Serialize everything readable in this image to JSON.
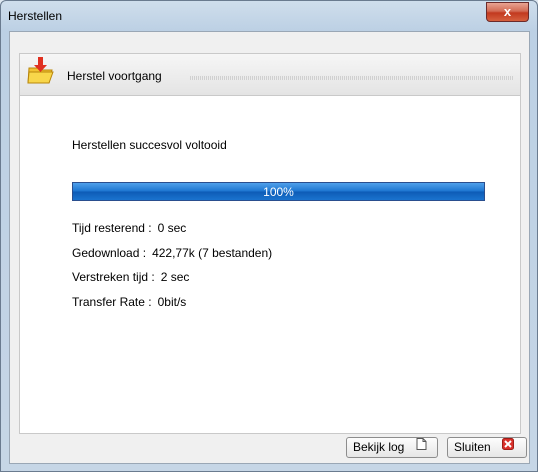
{
  "window": {
    "title": "Herstellen",
    "close_label": "x"
  },
  "panel": {
    "title": "Herstel voortgang"
  },
  "status": {
    "message": "Herstellen succesvol voltooid"
  },
  "progress": {
    "percent": 100,
    "label": "100%"
  },
  "info": [
    {
      "label": "Tijd resterend :",
      "value": "0 sec"
    },
    {
      "label": "Gedownload :",
      "value": "422,77k (7 bestanden)"
    },
    {
      "label": "Verstreken tijd :",
      "value": "2 sec"
    },
    {
      "label": "Transfer Rate :",
      "value": "0bit/s"
    }
  ],
  "buttons": {
    "view_log": "Bekijk log",
    "close": "Sluiten"
  },
  "icons": {
    "panel_icon": "folder-restore-icon",
    "log_icon": "document-icon",
    "close_icon": "red-x-icon"
  },
  "colors": {
    "progress_fill": "#1b74d0",
    "close_button": "#c2391f"
  }
}
